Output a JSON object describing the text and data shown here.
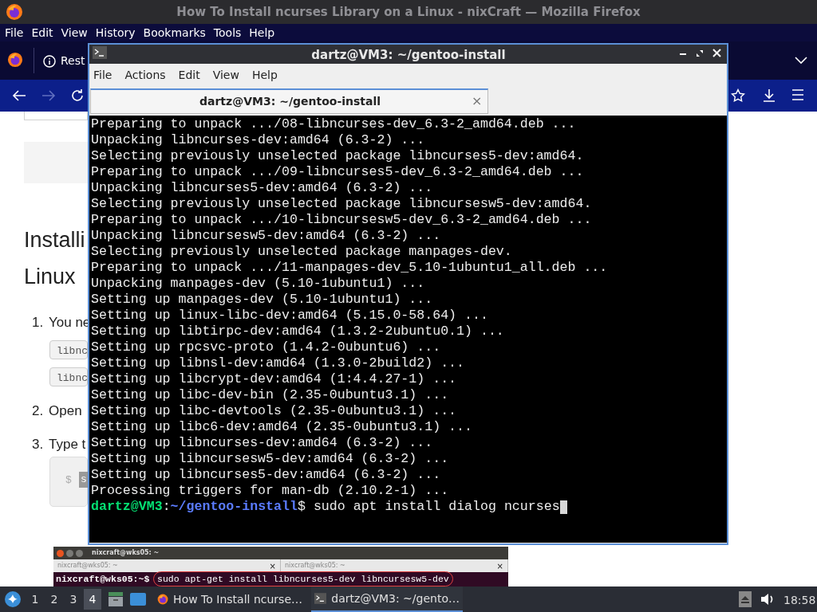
{
  "browser": {
    "title": "How To Install ncurses Library on a Linux - nixCraft — Mozilla Firefox",
    "menu": [
      "File",
      "Edit",
      "View",
      "History",
      "Bookmarks",
      "Tools",
      "Help"
    ],
    "tab_label": "Rest",
    "page": {
      "heading": [
        "Installi",
        "Linux"
      ],
      "steps": [
        {
          "number": "1.",
          "text": "You ne",
          "codes": [
            "libnc",
            "libnc"
          ]
        },
        {
          "number": "2.",
          "text": "Open"
        },
        {
          "number": "3.",
          "text": "Type t"
        }
      ],
      "command_box": {
        "prompt": "$",
        "text": "s"
      },
      "screenshot": {
        "title": "nixcraft@wks05: ~",
        "tabs": [
          "nixcraft@wks05: ~",
          "nixcraft@wks05: ~"
        ],
        "close": "×",
        "prompt": "nixcraft@wks05:~$",
        "command": "sudo apt-get install libncurses5-dev libncursesw5-dev"
      }
    }
  },
  "terminal": {
    "title": "dartz@VM3: ~/gentoo-install",
    "menu": [
      "File",
      "Actions",
      "Edit",
      "View",
      "Help"
    ],
    "tab": {
      "label": "dartz@VM3: ~/gentoo-install",
      "close": "×"
    },
    "lines": [
      "Preparing to unpack .../08-libncurses-dev_6.3-2_amd64.deb ...",
      "Unpacking libncurses-dev:amd64 (6.3-2) ...",
      "Selecting previously unselected package libncurses5-dev:amd64.",
      "Preparing to unpack .../09-libncurses5-dev_6.3-2_amd64.deb ...",
      "Unpacking libncurses5-dev:amd64 (6.3-2) ...",
      "Selecting previously unselected package libncursesw5-dev:amd64.",
      "Preparing to unpack .../10-libncursesw5-dev_6.3-2_amd64.deb ...",
      "Unpacking libncursesw5-dev:amd64 (6.3-2) ...",
      "Selecting previously unselected package manpages-dev.",
      "Preparing to unpack .../11-manpages-dev_5.10-1ubuntu1_all.deb ...",
      "Unpacking manpages-dev (5.10-1ubuntu1) ...",
      "Setting up manpages-dev (5.10-1ubuntu1) ...",
      "Setting up linux-libc-dev:amd64 (5.15.0-58.64) ...",
      "Setting up libtirpc-dev:amd64 (1.3.2-2ubuntu0.1) ...",
      "Setting up rpcsvc-proto (1.4.2-0ubuntu6) ...",
      "Setting up libnsl-dev:amd64 (1.3.0-2build2) ...",
      "Setting up libcrypt-dev:amd64 (1:4.4.27-1) ...",
      "Setting up libc-dev-bin (2.35-0ubuntu3.1) ...",
      "Setting up libc-devtools (2.35-0ubuntu3.1) ...",
      "Setting up libc6-dev:amd64 (2.35-0ubuntu3.1) ...",
      "Setting up libncurses-dev:amd64 (6.3-2) ...",
      "Setting up libncursesw5-dev:amd64 (6.3-2) ...",
      "Setting up libncurses5-dev:amd64 (6.3-2) ...",
      "Processing triggers for man-db (2.10.2-1) ..."
    ],
    "prompt": {
      "user": "dartz@VM3",
      "sep": ":",
      "path": "~/gentoo-install",
      "symbol": "$",
      "command": "sudo apt install dialog ncurses"
    }
  },
  "taskbar": {
    "workspaces": [
      {
        "label": "1",
        "selected": false
      },
      {
        "label": "2",
        "selected": false
      },
      {
        "label": "3",
        "selected": false
      },
      {
        "label": "4",
        "selected": true
      }
    ],
    "tasks": [
      {
        "kind": "browser",
        "label": "How To Install ncurse…",
        "selected": false
      },
      {
        "kind": "terminal",
        "label": "dartz@VM3: ~/gento…",
        "selected": true
      }
    ],
    "clock": "18:58"
  }
}
